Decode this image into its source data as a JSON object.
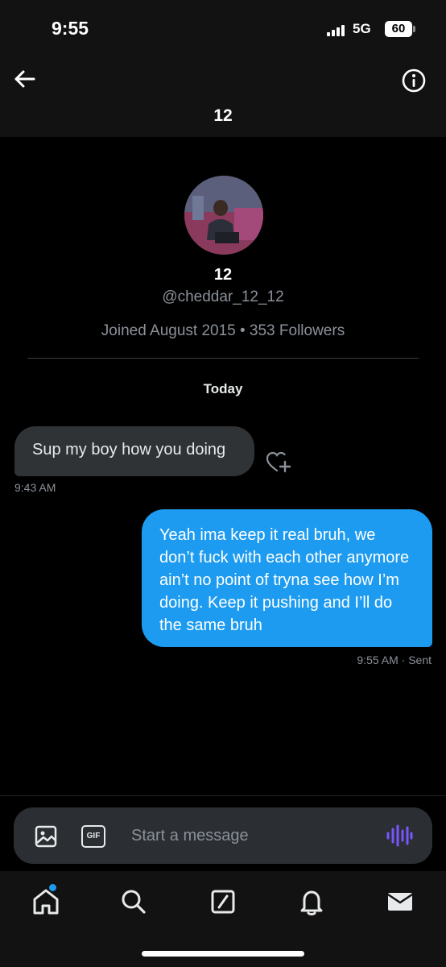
{
  "status_bar": {
    "time": "9:55",
    "network": "5G",
    "battery": "60"
  },
  "header": {
    "title": "12"
  },
  "profile": {
    "name": "12",
    "handle": "@cheddar_12_12",
    "meta": "Joined August 2015 • 353 Followers"
  },
  "conversation": {
    "day_label": "Today",
    "messages": [
      {
        "direction": "incoming",
        "text": "Sup my boy how you doing",
        "time": "9:43 AM"
      },
      {
        "direction": "outgoing",
        "text": "Yeah ima keep it real bruh, we don’t fuck with each other anymore ain’t no point of tryna see how I’m doing. Keep it pushing and I’ll do the same bruh",
        "time": "9:55 AM  · Sent"
      }
    ]
  },
  "composer": {
    "placeholder": "Start a message",
    "gif_label": "GIF"
  },
  "tab_bar": {
    "items": [
      {
        "icon": "home-icon",
        "has_notification": true
      },
      {
        "icon": "search-icon"
      },
      {
        "icon": "compose-icon"
      },
      {
        "icon": "bell-icon"
      },
      {
        "icon": "mail-icon"
      }
    ]
  },
  "colors": {
    "accent": "#1d9bf0",
    "voice": "#7856ff",
    "incoming_bubble": "#2f3336"
  }
}
